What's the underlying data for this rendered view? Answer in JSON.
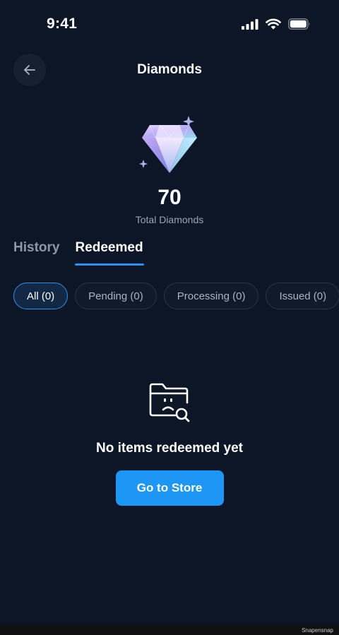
{
  "status": {
    "time": "9:41"
  },
  "header": {
    "title": "Diamonds"
  },
  "hero": {
    "total_value": "70",
    "total_label": "Total Diamonds"
  },
  "tabs": [
    {
      "label": "History",
      "active": false
    },
    {
      "label": "Redeemed",
      "active": true
    }
  ],
  "filters": [
    {
      "label": "All (0)",
      "selected": true
    },
    {
      "label": "Pending (0)",
      "selected": false
    },
    {
      "label": "Processing (0)",
      "selected": false
    },
    {
      "label": "Issued (0)",
      "selected": false
    }
  ],
  "empty_state": {
    "icon": "folder-sad-search-icon",
    "message": "No items redeemed yet",
    "button_label": "Go to Store"
  },
  "watermark": "Snapensnap",
  "colors": {
    "background": "#0c1626",
    "accent": "#2b8ff0",
    "button": "#1e96f5"
  }
}
